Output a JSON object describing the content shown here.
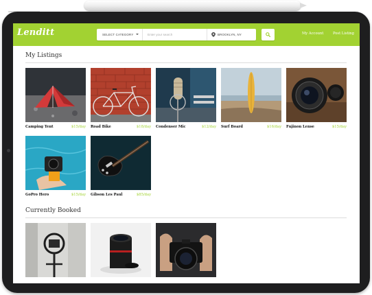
{
  "app": {
    "brand": "Lenditt",
    "accent_color": "#a2d232"
  },
  "header": {
    "category_select": "SELECT CATEGORY",
    "search_placeholder": "Enter your search",
    "location": "BROOKLYN, NY",
    "search_button_icon": "search-icon",
    "nav": [
      "My Account",
      "Post Listing"
    ]
  },
  "my_listings": {
    "title": "My Listings",
    "items": [
      {
        "name": "Camping Tent",
        "price": "$15/day",
        "image": "tent-photo"
      },
      {
        "name": "Road Bike",
        "price": "$18/day",
        "image": "bike-photo"
      },
      {
        "name": "Condenser Mic",
        "price": "$12/day",
        "image": "microphone-photo"
      },
      {
        "name": "Surf Board",
        "price": "$16/day",
        "image": "surfboard-photo"
      },
      {
        "name": "Fujinon Lense",
        "price": "$15/day",
        "image": "camera-lens-photo"
      },
      {
        "name": "GoPro Hero",
        "price": "$15/day",
        "image": "gopro-photo"
      },
      {
        "name": "Gibson Les Paul",
        "price": "$85/day",
        "image": "guitar-photo"
      }
    ]
  },
  "currently_booked": {
    "title": "Currently Booked",
    "items": [
      {
        "image": "gimbal-photo"
      },
      {
        "image": "lens-photo"
      },
      {
        "image": "dslr-photo"
      }
    ]
  }
}
